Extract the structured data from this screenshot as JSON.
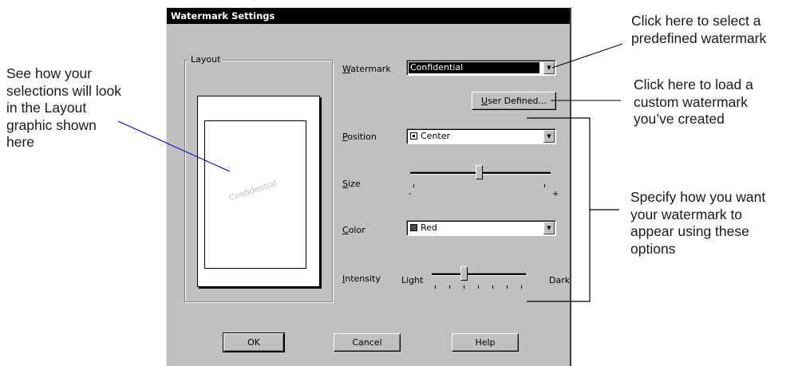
{
  "callouts": {
    "left": "See how your\nselections will look\nin the Layout\ngraphic shown\nhere",
    "top_right": "Click here to select a\npredefined watermark",
    "mid_right": "Click here to load a\ncustom watermark\nyou’ve created",
    "bottom_right": "Specify how you want\nyour watermark to\nappear using these\noptions"
  },
  "dialog": {
    "title": "Watermark Settings",
    "layout_group_label": "Layout",
    "preview_watermark_text": "Confidential",
    "watermark": {
      "label_accel": "W",
      "label_rest": "atermark",
      "value": "Confidential"
    },
    "user_defined_button": {
      "accel": "U",
      "rest": "ser Defined..."
    },
    "position": {
      "label_accel": "P",
      "label_rest": "osition",
      "value": "Center"
    },
    "size": {
      "label_accel": "S",
      "label_rest": "ize",
      "min_symbol": "-",
      "max_symbol": "+",
      "level": 0.49
    },
    "color": {
      "label_accel": "C",
      "label_rest": "olor",
      "value": "Red",
      "swatch_color": "#4a4a4a"
    },
    "intensity": {
      "label_accel": "I",
      "label_rest": "ntensity",
      "low_label": "Light",
      "high_label": "Dark",
      "level": 0.33
    },
    "buttons": {
      "ok": "OK",
      "cancel": "Cancel",
      "help": "Help"
    }
  },
  "colors": {
    "title_bar": "#000000",
    "dialog_face": "#c0c0c0",
    "connector_blue": "#0000c8"
  },
  "icons": {
    "dropdown": "▼"
  }
}
